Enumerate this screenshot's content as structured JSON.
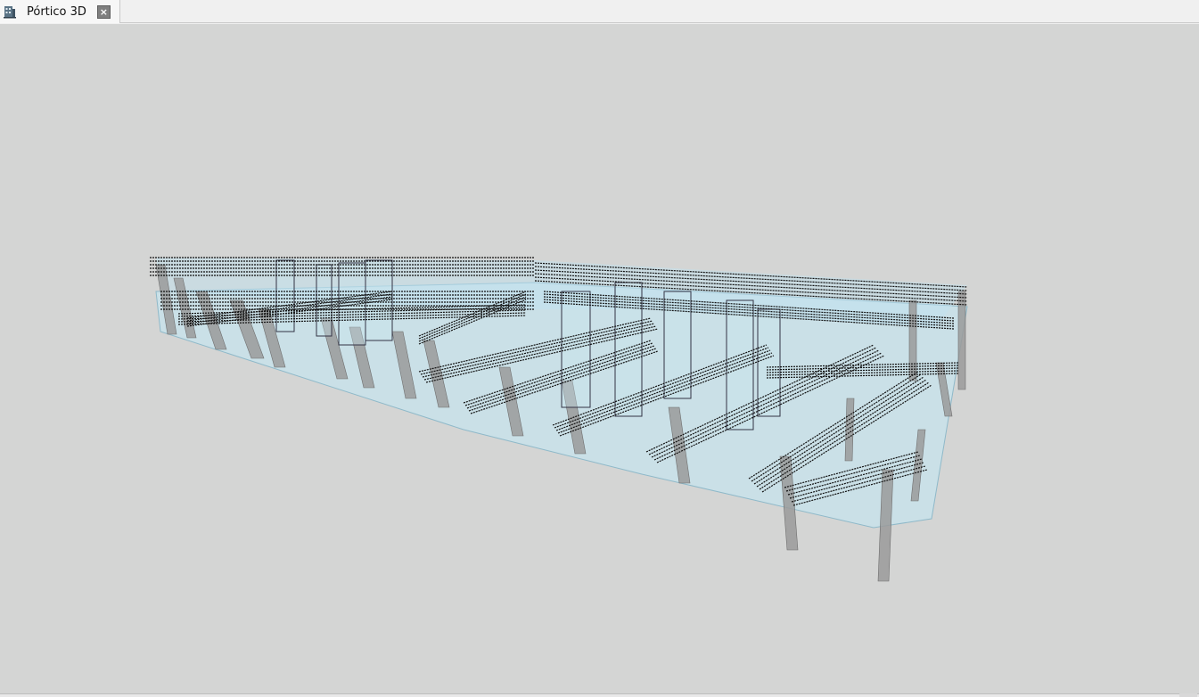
{
  "tab": {
    "icon": "building-icon",
    "label": "Pórtico 3D",
    "close_icon": "close-icon"
  },
  "viewport": {
    "background": "#d4d5d4",
    "slab_color": "#bfe6f2",
    "column_color": "#9a9a9a",
    "rebar_color": "#111111"
  }
}
